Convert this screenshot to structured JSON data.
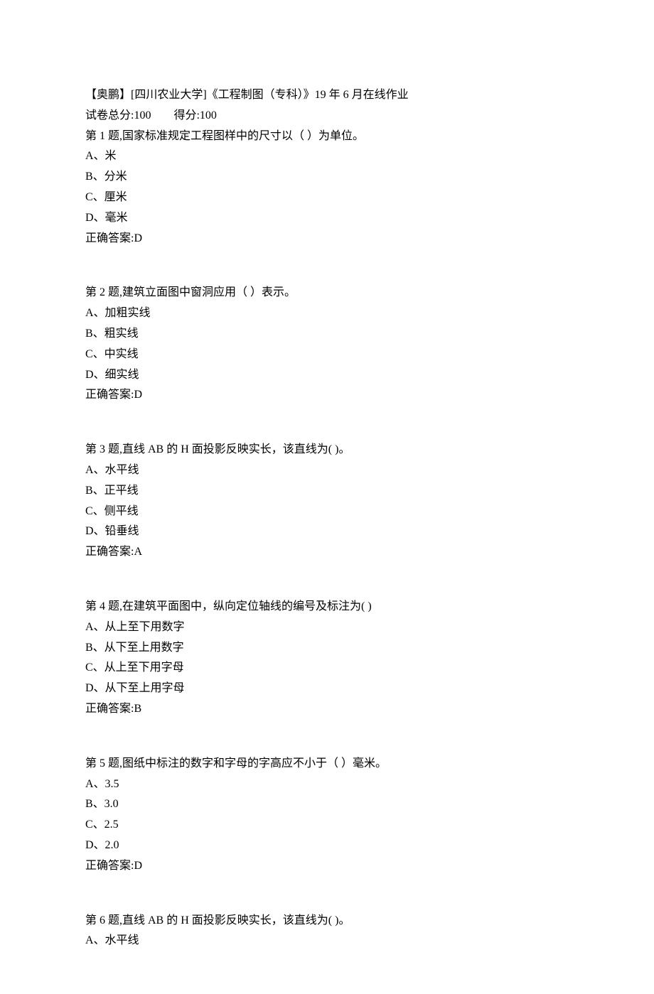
{
  "header": {
    "title": "【奥鹏】[四川农业大学]《工程制图（专科）》19 年 6 月在线作业",
    "score_label": "试卷总分:",
    "score_value": "100",
    "gain_label": "得分:",
    "gain_value": "100"
  },
  "questions": [
    {
      "prompt": "第 1 题,国家标准规定工程图样中的尺寸以（  ）为单位。",
      "options": [
        "A、米",
        "B、分米",
        "C、厘米",
        "D、毫米"
      ],
      "answer": "正确答案:D"
    },
    {
      "prompt": "第 2 题,建筑立面图中窗洞应用（ ）表示。",
      "options": [
        "A、加粗实线",
        "B、粗实线",
        "C、中实线",
        "D、细实线"
      ],
      "answer": "正确答案:D"
    },
    {
      "prompt": "第 3 题,直线 AB 的 H 面投影反映实长，该直线为(   )。",
      "options": [
        "A、水平线",
        "B、正平线",
        "C、侧平线",
        "D、铅垂线"
      ],
      "answer": "正确答案:A"
    },
    {
      "prompt": "第 4 题,在建筑平面图中，纵向定位轴线的编号及标注为(   )",
      "options": [
        "A、从上至下用数字",
        "B、从下至上用数字",
        "C、从上至下用字母",
        "D、从下至上用字母"
      ],
      "answer": "正确答案:B"
    },
    {
      "prompt": "第 5 题,图纸中标注的数字和字母的字高应不小于（  ）毫米。",
      "options": [
        "A、3.5",
        "B、3.0",
        "C、2.5",
        "D、2.0"
      ],
      "answer": "正确答案:D"
    },
    {
      "prompt": "第 6 题,直线 AB 的 H 面投影反映实长，该直线为(  )。",
      "options": [
        "A、水平线"
      ],
      "answer": ""
    }
  ]
}
